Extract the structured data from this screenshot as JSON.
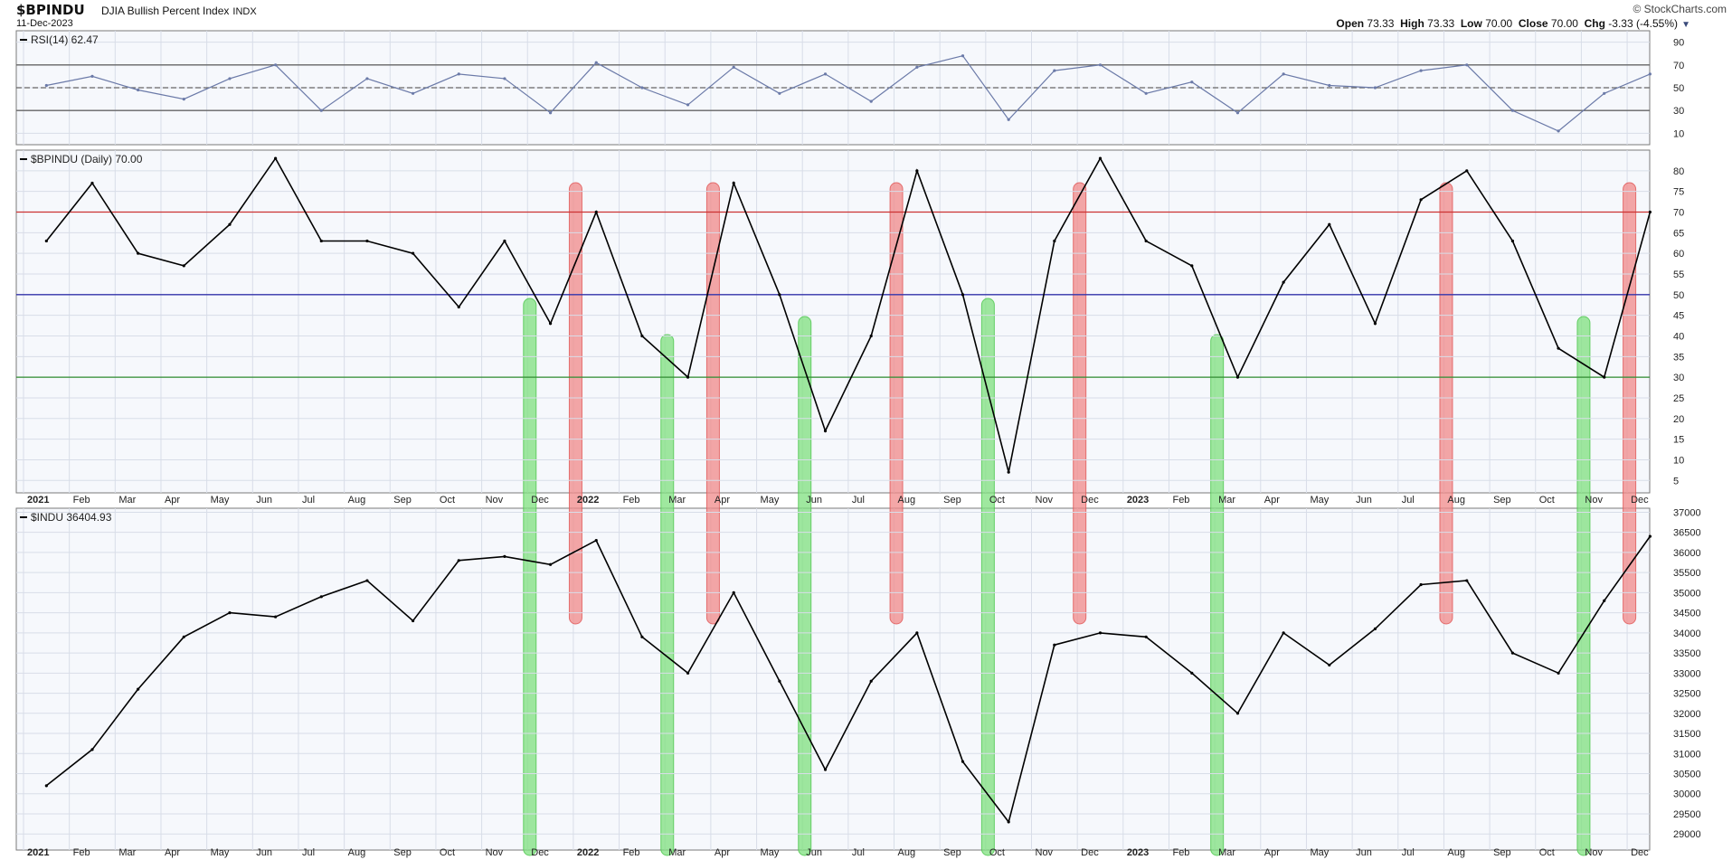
{
  "header": {
    "symbol": "$BPINDU",
    "name": "DJIA Bullish Percent Index",
    "exchange": "INDX",
    "date": "11-Dec-2023",
    "brand": "© StockCharts.com",
    "open_label": "Open",
    "open": "73.33",
    "high_label": "High",
    "high": "73.33",
    "low_label": "Low",
    "low": "70.00",
    "close_label": "Close",
    "close": "70.00",
    "chg_label": "Chg",
    "chg": "-3.33 (-4.55%)"
  },
  "colors": {
    "panel_bg": "#f6f8fc",
    "grid": "#d8dde8",
    "line": "#000000",
    "rsi_line": "#6b7aa8",
    "rsi_fill": "#4d8c8c",
    "red_line": "#cc3333",
    "blue_line": "#3333aa",
    "green_line": "#2e8b2e",
    "red_band": "#f08a8a",
    "green_band": "#7fe07f"
  },
  "chart_data": [
    {
      "type": "line",
      "title": "RSI(14) 62.47",
      "yticks": [
        10,
        30,
        50,
        70,
        90
      ],
      "ylim": [
        0,
        100
      ],
      "reference_lines": [
        30,
        50,
        70
      ],
      "x": [
        "2021-01",
        "2021-02",
        "2021-03",
        "2021-04",
        "2021-05",
        "2021-06",
        "2021-07",
        "2021-08",
        "2021-09",
        "2021-10",
        "2021-11",
        "2021-12",
        "2022-01",
        "2022-02",
        "2022-03",
        "2022-04",
        "2022-05",
        "2022-06",
        "2022-07",
        "2022-08",
        "2022-09",
        "2022-10",
        "2022-11",
        "2022-12",
        "2023-01",
        "2023-02",
        "2023-03",
        "2023-04",
        "2023-05",
        "2023-06",
        "2023-07",
        "2023-08",
        "2023-09",
        "2023-10",
        "2023-11",
        "2023-12"
      ],
      "values": [
        52,
        60,
        48,
        40,
        58,
        70,
        30,
        58,
        45,
        62,
        58,
        28,
        72,
        50,
        35,
        68,
        45,
        62,
        38,
        68,
        78,
        22,
        65,
        70,
        45,
        55,
        28,
        62,
        52,
        50,
        65,
        70,
        30,
        12,
        45,
        62
      ],
      "legend": "top-left"
    },
    {
      "type": "line",
      "title": "$BPINDU (Daily) 70.00",
      "yticks": [
        5,
        10,
        15,
        20,
        25,
        30,
        35,
        40,
        45,
        50,
        55,
        60,
        65,
        70,
        75,
        80
      ],
      "ylim": [
        2,
        85
      ],
      "reference_lines": [
        {
          "value": 70,
          "color": "red"
        },
        {
          "value": 50,
          "color": "blue"
        },
        {
          "value": 30,
          "color": "green"
        }
      ],
      "x": [
        "2021-01",
        "2021-02",
        "2021-03",
        "2021-04",
        "2021-05",
        "2021-06",
        "2021-07",
        "2021-08",
        "2021-09",
        "2021-10",
        "2021-11",
        "2021-12",
        "2022-01",
        "2022-02",
        "2022-03",
        "2022-04",
        "2022-05",
        "2022-06",
        "2022-07",
        "2022-08",
        "2022-09",
        "2022-10",
        "2022-11",
        "2022-12",
        "2023-01",
        "2023-02",
        "2023-03",
        "2023-04",
        "2023-05",
        "2023-06",
        "2023-07",
        "2023-08",
        "2023-09",
        "2023-10",
        "2023-11",
        "2023-12"
      ],
      "values": [
        63,
        77,
        60,
        57,
        67,
        83,
        63,
        63,
        60,
        47,
        63,
        43,
        70,
        40,
        30,
        77,
        50,
        17,
        40,
        80,
        50,
        7,
        63,
        83,
        63,
        57,
        30,
        53,
        67,
        43,
        73,
        80,
        63,
        37,
        30,
        70
      ],
      "legend": "top-left"
    },
    {
      "type": "line",
      "title": "$INDU 36404.93",
      "yticks": [
        29000,
        29500,
        30000,
        30500,
        31000,
        31500,
        32000,
        32500,
        33000,
        33500,
        34000,
        34500,
        35000,
        35500,
        36000,
        36500,
        37000
      ],
      "ylim": [
        28600,
        37100
      ],
      "x": [
        "2021-01",
        "2021-02",
        "2021-03",
        "2021-04",
        "2021-05",
        "2021-06",
        "2021-07",
        "2021-08",
        "2021-09",
        "2021-10",
        "2021-11",
        "2021-12",
        "2022-01",
        "2022-02",
        "2022-03",
        "2022-04",
        "2022-05",
        "2022-06",
        "2022-07",
        "2022-08",
        "2022-09",
        "2022-10",
        "2022-11",
        "2022-12",
        "2023-01",
        "2023-02",
        "2023-03",
        "2023-04",
        "2023-05",
        "2023-06",
        "2023-07",
        "2023-08",
        "2023-09",
        "2023-10",
        "2023-11",
        "2023-12"
      ],
      "values": [
        30200,
        31100,
        32600,
        33900,
        34500,
        34400,
        34900,
        35300,
        34300,
        35800,
        35900,
        35700,
        36300,
        33900,
        33000,
        35000,
        32800,
        30600,
        32800,
        34000,
        30800,
        29300,
        33700,
        34000,
        33900,
        33000,
        32000,
        34000,
        33200,
        34100,
        35200,
        35300,
        33500,
        33000,
        34800,
        36400
      ],
      "legend": "top-left"
    }
  ],
  "x_axis_labels": [
    {
      "label": "2021",
      "bold": true
    },
    {
      "label": "Feb"
    },
    {
      "label": "Mar"
    },
    {
      "label": "Apr"
    },
    {
      "label": "May"
    },
    {
      "label": "Jun"
    },
    {
      "label": "Jul"
    },
    {
      "label": "Aug"
    },
    {
      "label": "Sep"
    },
    {
      "label": "Oct"
    },
    {
      "label": "Nov"
    },
    {
      "label": "Dec"
    },
    {
      "label": "2022",
      "bold": true
    },
    {
      "label": "Feb"
    },
    {
      "label": "Mar"
    },
    {
      "label": "Apr"
    },
    {
      "label": "May"
    },
    {
      "label": "Jun"
    },
    {
      "label": "Jul"
    },
    {
      "label": "Aug"
    },
    {
      "label": "Sep"
    },
    {
      "label": "Oct"
    },
    {
      "label": "Nov"
    },
    {
      "label": "Dec"
    },
    {
      "label": "2023",
      "bold": true
    },
    {
      "label": "Feb"
    },
    {
      "label": "Mar"
    },
    {
      "label": "Apr"
    },
    {
      "label": "May"
    },
    {
      "label": "Jun"
    },
    {
      "label": "Jul"
    },
    {
      "label": "Aug"
    },
    {
      "label": "Sep"
    },
    {
      "label": "Oct"
    },
    {
      "label": "Nov"
    },
    {
      "label": "Dec"
    }
  ],
  "bands": [
    {
      "color": "green",
      "month": "2021-12"
    },
    {
      "color": "red",
      "month": "2022-01"
    },
    {
      "color": "green",
      "month": "2022-03"
    },
    {
      "color": "red",
      "month": "2022-04"
    },
    {
      "color": "green",
      "month": "2022-06"
    },
    {
      "color": "red",
      "month": "2022-08"
    },
    {
      "color": "green",
      "month": "2022-10"
    },
    {
      "color": "red",
      "month": "2022-12"
    },
    {
      "color": "green",
      "month": "2023-03"
    },
    {
      "color": "red",
      "month": "2023-08"
    },
    {
      "color": "green",
      "month": "2023-11"
    },
    {
      "color": "red",
      "month": "2023-12"
    }
  ]
}
